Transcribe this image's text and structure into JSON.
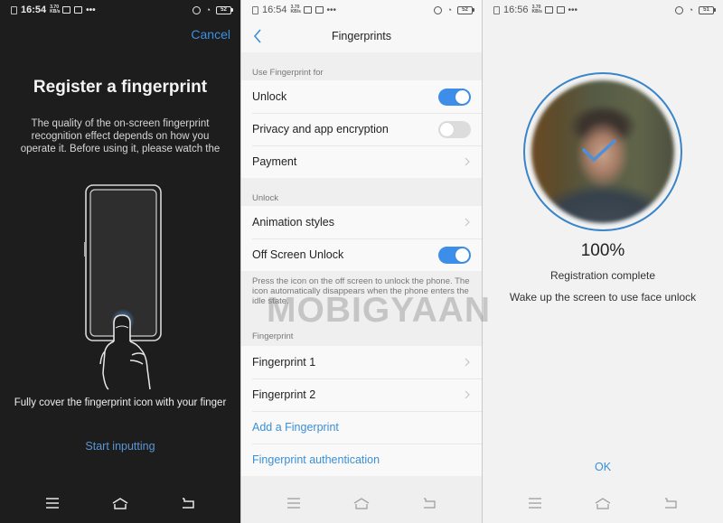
{
  "screens": {
    "register": {
      "status": {
        "time": "16:54",
        "speed": "3.70 KB/s",
        "battery": "52"
      },
      "cancel_label": "Cancel",
      "title": "Register a fingerprint",
      "description": "The quality of the on-screen fingerprint recognition effect depends on how you operate it. Before using it, please watch the",
      "cover_instruction": "Fully cover the fingerprint icon with your finger",
      "start_label": "Start inputting"
    },
    "fingerprints": {
      "status": {
        "time": "16:54",
        "speed": "3.70 KB/s",
        "battery": "52"
      },
      "title": "Fingerprints",
      "sections": [
        {
          "label": "Use Fingerprint for",
          "rows": [
            {
              "label": "Unlock",
              "control": "toggle",
              "on": true
            },
            {
              "label": "Privacy and app encryption",
              "control": "toggle",
              "on": false
            },
            {
              "label": "Payment",
              "control": "chevron"
            }
          ]
        },
        {
          "label": "Unlock",
          "rows": [
            {
              "label": "Animation styles",
              "control": "chevron"
            },
            {
              "label": "Off Screen Unlock",
              "control": "toggle",
              "on": true
            }
          ],
          "note": "Press the icon on the off screen to unlock the phone. The icon automatically disappears when the phone enters the idle state."
        },
        {
          "label": "Fingerprint",
          "rows": [
            {
              "label": "Fingerprint 1",
              "control": "chevron"
            },
            {
              "label": "Fingerprint 2",
              "control": "chevron"
            },
            {
              "label": "Add a Fingerprint",
              "control": "link"
            },
            {
              "label": "Fingerprint authentication",
              "control": "link"
            }
          ]
        }
      ]
    },
    "face": {
      "status": {
        "time": "16:56",
        "speed": "3.70 KB/s",
        "battery": "51"
      },
      "progress_text": "100%",
      "progress": 1.0,
      "status_text": "Registration complete",
      "hint": "Wake up the screen to use face unlock",
      "ok_label": "OK"
    }
  },
  "watermark": "MOBIGYAAN",
  "colors": {
    "accent": "#3d8ee8",
    "link": "#3a8fd6",
    "dark_bg": "#1d1d1d",
    "light_bg": "#efefef"
  }
}
